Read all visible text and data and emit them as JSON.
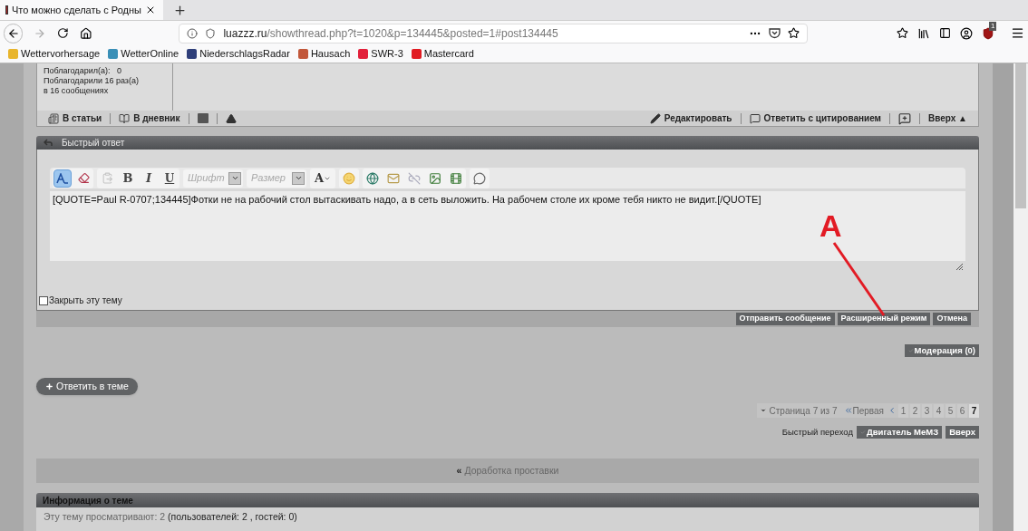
{
  "browser": {
    "tab": {
      "title": "Что можно сделать с Родны",
      "selected": true
    },
    "address": {
      "domain": "luazzz.ru",
      "path": "/showthread.php?t=1020&p=134445&posted=1#post134445"
    },
    "extension_badge": "1",
    "bookmarks": [
      {
        "label": "Wettervorhersage",
        "color": "#e8b52c"
      },
      {
        "label": "WetterOnline",
        "color": "#3a8fb7"
      },
      {
        "label": "NiederschlagsRadar",
        "color": "#2f3f7a"
      },
      {
        "label": "Hausach",
        "color": "#c2573a"
      },
      {
        "label": "SWR-3",
        "color": "#e2203a"
      },
      {
        "label": "Mastercard",
        "color": "#e11b22"
      }
    ]
  },
  "post": {
    "user_stats": [
      "Поблагодарил(а):   0",
      "Поблагодарили 16 раз(а)",
      "в 16 сообщениях"
    ],
    "left_actions": [
      {
        "kind": "articles",
        "label": "В статьи"
      },
      {
        "kind": "diary",
        "label": "В дневник"
      },
      {
        "kind": "ip"
      },
      {
        "kind": "report"
      }
    ],
    "right_actions": [
      {
        "kind": "edit",
        "label": "Редактировать"
      },
      {
        "kind": "quote",
        "label": "Ответить с цитированием"
      },
      {
        "kind": "multiquote"
      },
      {
        "kind": "top",
        "label": "Вверх ▲"
      }
    ]
  },
  "quick_reply": {
    "title": "Быстрый ответ",
    "toolbar": [
      [
        {
          "kind": "mode",
          "selected": true
        },
        {
          "kind": "clear",
          "selected": false
        }
      ],
      [
        {
          "kind": "paste"
        },
        {
          "kind": "bold",
          "label": "B"
        },
        {
          "kind": "italic",
          "label": "I"
        },
        {
          "kind": "underline",
          "label": "U"
        }
      ],
      [
        {
          "kind": "select",
          "placeholder": "Шрифт"
        }
      ],
      [
        {
          "kind": "select",
          "placeholder": "Размер"
        }
      ],
      [
        {
          "kind": "color",
          "label": "A"
        }
      ],
      [
        {
          "kind": "smiley"
        }
      ],
      [
        {
          "kind": "link"
        },
        {
          "kind": "email"
        },
        {
          "kind": "unlink"
        },
        {
          "kind": "image"
        },
        {
          "kind": "video"
        }
      ],
      [
        {
          "kind": "quote"
        }
      ]
    ],
    "value": "[QUOTE=Paul R-0707;134445]Фотки не на рабочий стол вытаскивать надо, а в сеть выложить. На рабочем столе их кроме тебя никто не видит.[/QUOTE]",
    "close_topic": {
      "label": "Закрыть эту тему",
      "checked": false
    },
    "buttons": [
      "Отправить сообщение",
      "Расширенный режим",
      "Отмена"
    ]
  },
  "moderation": "Модерация (0)",
  "reply_button": "Ответить в теме",
  "pagination": {
    "label": "Страница 7 из 7",
    "first": "Первая",
    "pages": [
      {
        "label": "1",
        "selected": false
      },
      {
        "label": "2",
        "selected": false
      },
      {
        "label": "3",
        "selected": false
      },
      {
        "label": "4",
        "selected": false
      },
      {
        "label": "5",
        "selected": false
      },
      {
        "label": "6",
        "selected": false
      },
      {
        "label": "7",
        "selected": true
      }
    ]
  },
  "quick_nav": {
    "label": "Быстрый переход",
    "forum": "Двигатель МеМЗ",
    "top": "Вверх"
  },
  "thread_nav": {
    "mark": "«",
    "prev": "Доработка проставки"
  },
  "thread_info": {
    "title": "Информация о теме",
    "viewers": "Эту тему просматривают: 2",
    "viewers_detail": "(пользователей: 2 , гостей: 0)"
  },
  "annotation": {
    "label": "A"
  }
}
